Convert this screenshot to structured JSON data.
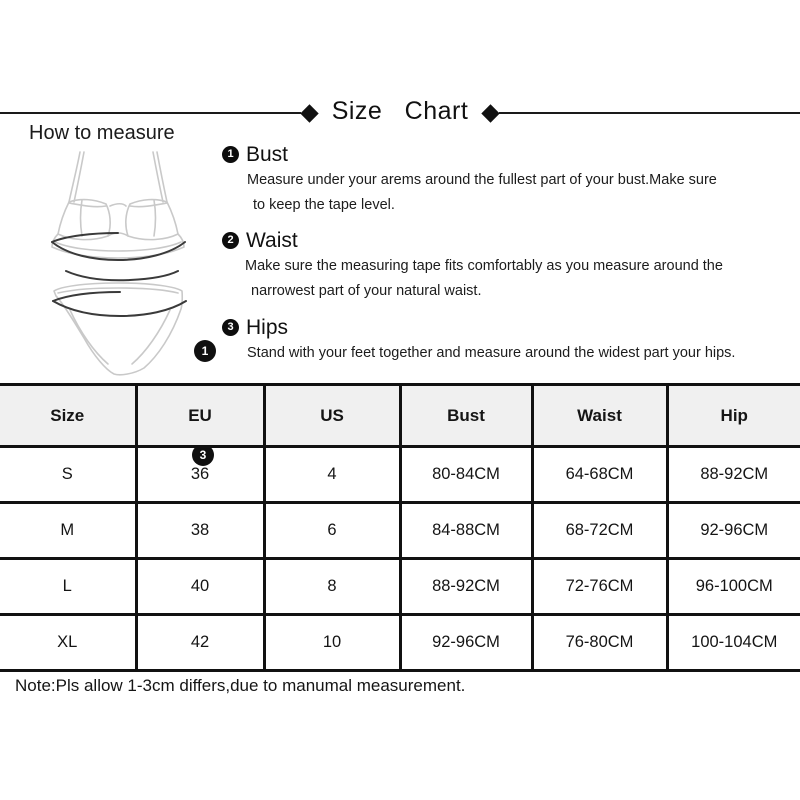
{
  "header": {
    "title": "Size   Chart",
    "left_diamond": "diamond-marker",
    "right_diamond": "diamond-marker"
  },
  "how_to_measure": {
    "label": "How to measure",
    "markers": [
      {
        "number": "1",
        "refers_to": "Bust"
      },
      {
        "number": "2",
        "refers_to": "Waist"
      },
      {
        "number": "3",
        "refers_to": "Hips"
      }
    ]
  },
  "instructions": [
    {
      "number": "1",
      "title": "Bust",
      "line1": "Measure under your arems around the fullest part of your bust.Make sure",
      "line2": "to keep the tape level."
    },
    {
      "number": "2",
      "title": "Waist",
      "line1": "Make sure the measuring tape fits comfortably as you measure around the",
      "line2": "narrowest part of your natural waist."
    },
    {
      "number": "3",
      "title": "Hips",
      "line1": "Stand with your feet together and measure around the widest part your hips.",
      "line2": ""
    }
  ],
  "table": {
    "columns": [
      "Size",
      "EU",
      "US",
      "Bust",
      "Waist",
      "Hip"
    ],
    "rows": [
      {
        "size": "S",
        "eu": "36",
        "us": "4",
        "bust": "80-84CM",
        "waist": "64-68CM",
        "hip": "88-92CM"
      },
      {
        "size": "M",
        "eu": "38",
        "us": "6",
        "bust": "84-88CM",
        "waist": "68-72CM",
        "hip": "92-96CM"
      },
      {
        "size": "L",
        "eu": "40",
        "us": "8",
        "bust": "88-92CM",
        "waist": "72-76CM",
        "hip": "96-100CM"
      },
      {
        "size": "XL",
        "eu": "42",
        "us": "10",
        "bust": "92-96CM",
        "waist": "76-80CM",
        "hip": "100-104CM"
      }
    ]
  },
  "note": "Note:Pls allow 1-3cm differs,due to manumal measurement.",
  "colors": {
    "text": "#111111",
    "rule": "#1a1a1a",
    "table_border": "#111111",
    "header_fill": "#f0f0f0",
    "marker_fill": "#101010",
    "garment_outline": "#c9c9c9",
    "measure_line": "#3a3a3a"
  }
}
